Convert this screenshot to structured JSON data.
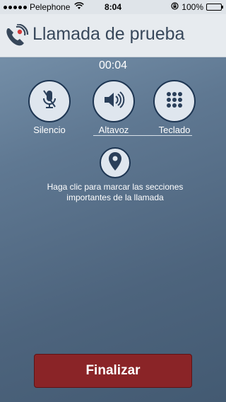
{
  "status_bar": {
    "carrier": "Pelephone",
    "time": "8:04",
    "battery": "100%",
    "icons": [
      "signal-dots-icon",
      "wifi-icon",
      "rotation-lock-icon",
      "battery-icon"
    ]
  },
  "header": {
    "title": "Llamada de prueba",
    "logo_icon": "phone-logo-icon"
  },
  "call": {
    "timer": "00:04"
  },
  "controls": [
    {
      "label": "Silencio",
      "icon": "mute-microphone-icon"
    },
    {
      "label": "Altavoz",
      "icon": "speaker-icon"
    },
    {
      "label": "Teclado",
      "icon": "keypad-icon"
    }
  ],
  "marker": {
    "icon": "location-pin-icon",
    "hint": "Haga clic para marcar las secciones importantes de la llamada"
  },
  "end_call": {
    "label": "Finalizar"
  },
  "colors": {
    "end_button": "#8a2427",
    "accent_dark": "#1d3552",
    "header_bg": "#e7ebef"
  }
}
